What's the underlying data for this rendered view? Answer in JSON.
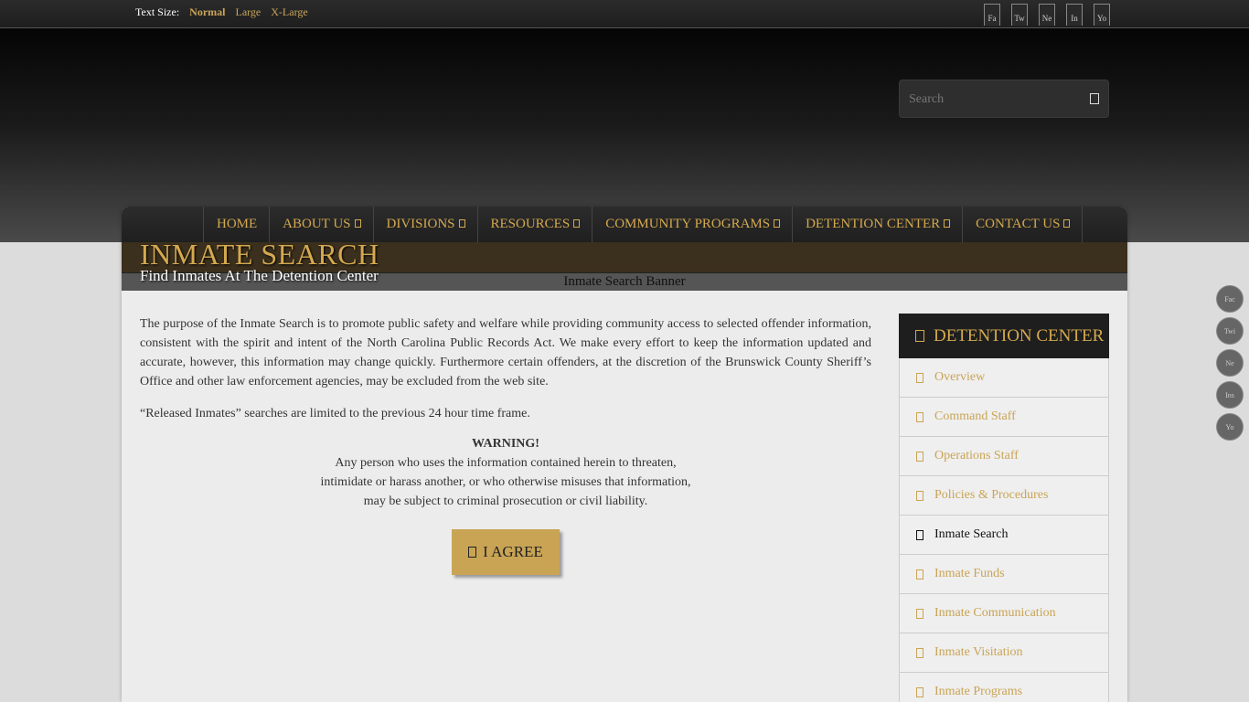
{
  "topbar": {
    "text_size_label": "Text Size:",
    "options": [
      "Normal",
      "Large",
      "X-Large"
    ],
    "social_icons": [
      "Fa",
      "Tw",
      "Ne",
      "In",
      "Yo"
    ]
  },
  "search": {
    "placeholder": "Search"
  },
  "nav": {
    "items": [
      "HOME",
      "ABOUT US",
      "DIVISIONS",
      "RESOURCES",
      "COMMUNITY PROGRAMS",
      "DETENTION CENTER",
      "CONTACT US"
    ]
  },
  "page": {
    "title": "INMATE SEARCH",
    "subtitle": "Find Inmates At The Detention Center",
    "banner_alt": "Inmate Search Banner"
  },
  "content": {
    "para1": "The purpose of the Inmate Search is to promote public safety and welfare while providing community access to selected offender information, consistent with the spirit and intent of the North Carolina Public Records Act.  We make every effort to keep the information updated and accurate, however, this information may change quickly. Furthermore certain offenders, at the discretion of the Brunswick County Sheriff’s Office and other law enforcement agencies, may be excluded from the web site.",
    "para2": "“Released Inmates” searches are limited to the previous 24 hour time frame.",
    "warning_title": "WARNING!",
    "warning_line1": "Any person who uses the information contained herein to threaten,",
    "warning_line2": "intimidate or harass another, or who otherwise misuses that information,",
    "warning_line3": "may be subject to criminal prosecution or civil liability.",
    "agree_button": "I AGREE"
  },
  "sidebar": {
    "heading": "DETENTION CENTER",
    "items": [
      "Overview",
      "Command Staff",
      "Operations Staff",
      "Policies & Procedures",
      "Inmate Search",
      "Inmate Funds",
      "Inmate Communication",
      "Inmate Visitation",
      "Inmate Programs"
    ],
    "current": "Inmate Search"
  },
  "floating_social": [
    "Fac",
    "Twi",
    "Ne",
    "Ins",
    "Yo"
  ],
  "colors": {
    "accent": "#c9a455",
    "title_bar": "#3b2f1d",
    "nav_bg": "#1f1f1f"
  }
}
